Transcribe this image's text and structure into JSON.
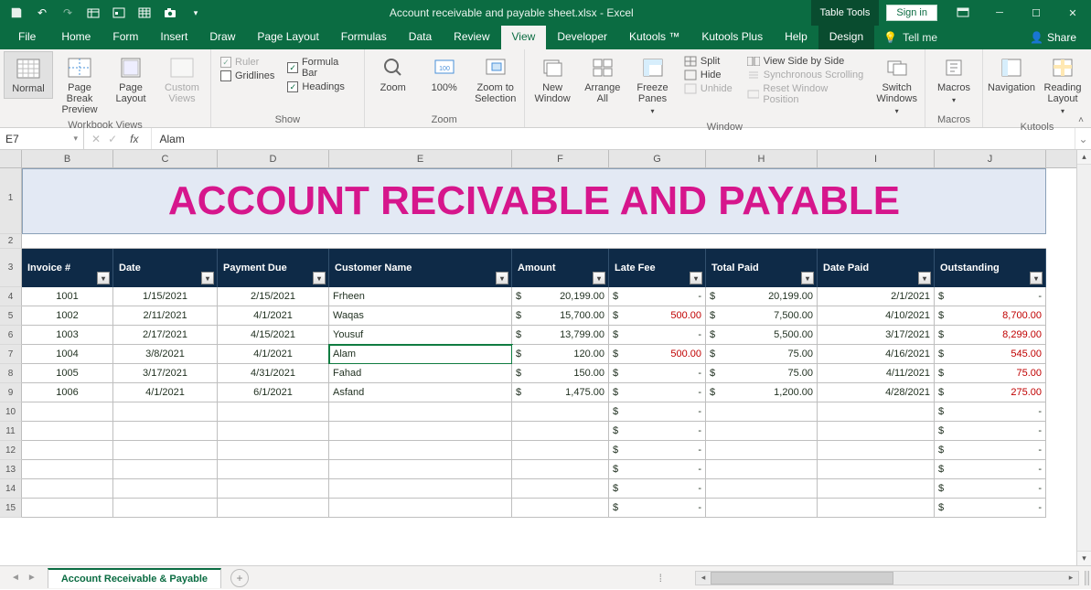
{
  "titlebar": {
    "title": "Account receivable and payable sheet.xlsx - Excel",
    "tabletools": "Table Tools",
    "signin": "Sign in"
  },
  "tabs": {
    "file": "File",
    "home": "Home",
    "form": "Form",
    "insert": "Insert",
    "draw": "Draw",
    "pagelayout": "Page Layout",
    "formulas": "Formulas",
    "data": "Data",
    "review": "Review",
    "view": "View",
    "developer": "Developer",
    "kutools": "Kutools ™",
    "kutoolsplus": "Kutools Plus",
    "help": "Help",
    "design": "Design",
    "tellme": "Tell me",
    "share": "Share"
  },
  "ribbon": {
    "wb_views": {
      "label": "Workbook Views",
      "normal": "Normal",
      "pbp": "Page Break\nPreview",
      "pl": "Page\nLayout",
      "cv": "Custom\nViews"
    },
    "show": {
      "label": "Show",
      "ruler": "Ruler",
      "formulabar": "Formula Bar",
      "gridlines": "Gridlines",
      "headings": "Headings"
    },
    "zoom": {
      "label": "Zoom",
      "zoom": "Zoom",
      "z100": "100%",
      "zts": "Zoom to\nSelection"
    },
    "window": {
      "label": "Window",
      "nw": "New\nWindow",
      "aa": "Arrange\nAll",
      "fp": "Freeze\nPanes",
      "split": "Split",
      "hide": "Hide",
      "unhide": "Unhide",
      "vsbs": "View Side by Side",
      "ss": "Synchronous Scrolling",
      "rwp": "Reset Window Position",
      "sw": "Switch\nWindows"
    },
    "macros": {
      "label": "Macros",
      "btn": "Macros"
    },
    "kutools": {
      "label": "Kutools",
      "nav": "Navigation",
      "rl": "Reading\nLayout"
    }
  },
  "namebox": "E7",
  "formula": "Alam",
  "bigheader": "ACCOUNT RECIVABLE AND PAYABLE",
  "cols": [
    "B",
    "C",
    "D",
    "E",
    "F",
    "G",
    "H",
    "I",
    "J"
  ],
  "headers": {
    "b": "Invoice #",
    "c": "Date",
    "d": "Payment Due",
    "e": "Customer Name",
    "f": "Amount",
    "g": "Late Fee",
    "h": "Total Paid",
    "i": "Date Paid",
    "j": "Outstanding"
  },
  "rows": [
    {
      "inv": "1001",
      "date": "1/15/2021",
      "due": "2/15/2021",
      "name": "Frheen",
      "amt": "20,199.00",
      "fee": "-",
      "paid": "20,199.00",
      "dpaid": "2/1/2021",
      "out": "-",
      "feeRed": false,
      "outRed": false
    },
    {
      "inv": "1002",
      "date": "2/11/2021",
      "due": "4/1/2021",
      "name": "Waqas",
      "amt": "15,700.00",
      "fee": "500.00",
      "paid": "7,500.00",
      "dpaid": "4/10/2021",
      "out": "8,700.00",
      "feeRed": true,
      "outRed": true
    },
    {
      "inv": "1003",
      "date": "2/17/2021",
      "due": "4/15/2021",
      "name": "Yousuf",
      "amt": "13,799.00",
      "fee": "-",
      "paid": "5,500.00",
      "dpaid": "3/17/2021",
      "out": "8,299.00",
      "feeRed": false,
      "outRed": true
    },
    {
      "inv": "1004",
      "date": "3/8/2021",
      "due": "4/1/2021",
      "name": "Alam",
      "amt": "120.00",
      "fee": "500.00",
      "paid": "75.00",
      "dpaid": "4/16/2021",
      "out": "545.00",
      "feeRed": true,
      "outRed": true
    },
    {
      "inv": "1005",
      "date": "3/17/2021",
      "due": "4/31/2021",
      "name": "Fahad",
      "amt": "150.00",
      "fee": "-",
      "paid": "75.00",
      "dpaid": "4/11/2021",
      "out": "75.00",
      "feeRed": false,
      "outRed": true
    },
    {
      "inv": "1006",
      "date": "4/1/2021",
      "due": "6/1/2021",
      "name": "Asfand",
      "amt": "1,475.00",
      "fee": "-",
      "paid": "1,200.00",
      "dpaid": "4/28/2021",
      "out": "275.00",
      "feeRed": false,
      "outRed": true
    }
  ],
  "sheettab": "Account Receivable & Payable"
}
